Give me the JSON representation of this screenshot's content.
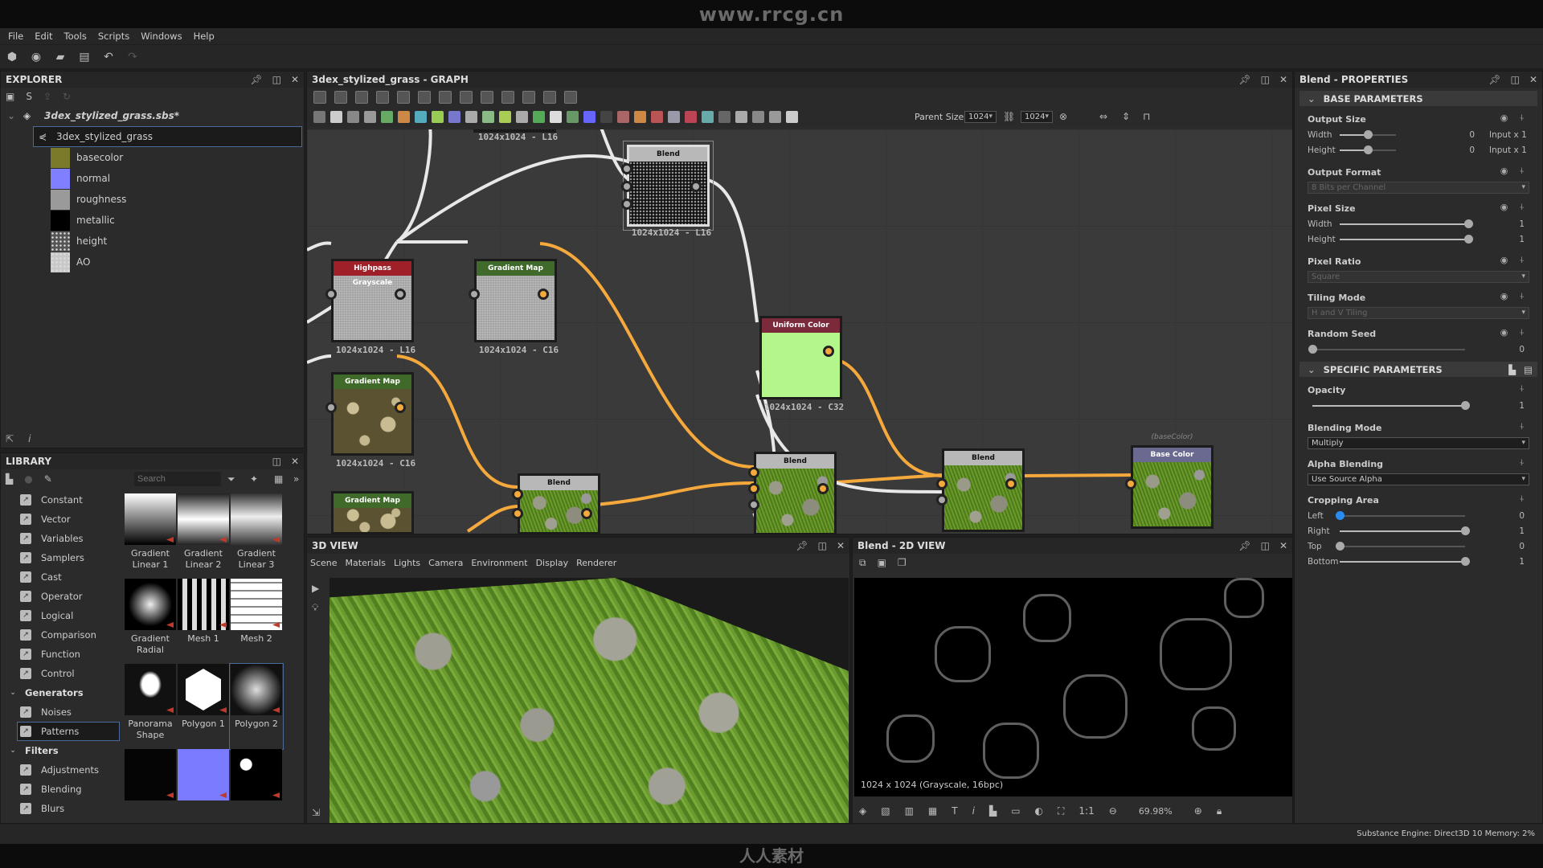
{
  "watermark_top": "www.rrcg.cn",
  "watermark_bottom": "人人素材",
  "menu": [
    "File",
    "Edit",
    "Tools",
    "Scripts",
    "Windows",
    "Help"
  ],
  "explorer": {
    "title": "EXPLORER",
    "package": "3dex_stylized_grass.sbs*",
    "graph": "3dex_stylized_grass",
    "outputs": [
      {
        "label": "basecolor",
        "color": "#7a7a2a"
      },
      {
        "label": "normal",
        "color": "#7f7fff"
      },
      {
        "label": "roughness",
        "color": "#9a9a9a"
      },
      {
        "label": "metallic",
        "color": "#000000"
      },
      {
        "label": "height",
        "color": "#555555"
      },
      {
        "label": "AO",
        "color": "#c8c8c8"
      }
    ]
  },
  "library": {
    "title": "LIBRARY",
    "search_placeholder": "Search",
    "categories": [
      {
        "label": "Constant"
      },
      {
        "label": "Vector"
      },
      {
        "label": "Variables"
      },
      {
        "label": "Samplers"
      },
      {
        "label": "Cast"
      },
      {
        "label": "Operator"
      },
      {
        "label": "Logical"
      },
      {
        "label": "Comparison"
      },
      {
        "label": "Function"
      },
      {
        "label": "Control"
      },
      {
        "label": "Generators",
        "group": true
      },
      {
        "label": "Noises"
      },
      {
        "label": "Patterns",
        "selected": true
      },
      {
        "label": "Filters",
        "group": true
      },
      {
        "label": "Adjustments"
      },
      {
        "label": "Blending"
      },
      {
        "label": "Blurs"
      }
    ],
    "items": [
      {
        "label": "Gradient Linear 1"
      },
      {
        "label": "Gradient Linear 2"
      },
      {
        "label": "Gradient Linear 3"
      },
      {
        "label": "Gradient Radial"
      },
      {
        "label": "Mesh 1"
      },
      {
        "label": "Mesh 2"
      },
      {
        "label": "Panorama Shape"
      },
      {
        "label": "Polygon 1"
      },
      {
        "label": "Polygon 2",
        "selected": true
      },
      {
        "label": ""
      },
      {
        "label": ""
      },
      {
        "label": ""
      }
    ]
  },
  "graph": {
    "title": "3dex_stylized_grass - GRAPH",
    "parent_size_label": "Parent Size:",
    "size_w": "1024",
    "size_h": "1024",
    "nodes": {
      "noise": {
        "caption": "1024x1024 - L16"
      },
      "blend_top": {
        "title": "Blend",
        "caption": "1024x1024 - L16"
      },
      "highpass": {
        "title": "Highpass Grayscale",
        "caption": "1024x1024 - L16"
      },
      "gradmap1": {
        "title": "Gradient Map",
        "caption": "1024x1024 - C16"
      },
      "gradmap2": {
        "title": "Gradient Map",
        "caption": "1024x1024 - C16"
      },
      "gradmap3": {
        "title": "Gradient Map"
      },
      "blend_low": {
        "title": "Blend"
      },
      "uniform": {
        "title": "Uniform Color",
        "caption": "1024x1024 - C32"
      },
      "blend_mid": {
        "title": "Blend"
      },
      "blend_right": {
        "title": "Blend"
      },
      "basecolor": {
        "title": "Base Color",
        "identifier": "(baseColor)"
      }
    },
    "colors": {
      "color_wire": "#f5a93c",
      "gray_wire": "#e8e8e8",
      "uniform_color": "#b4f58c"
    }
  },
  "view3d": {
    "title": "3D VIEW",
    "menu": [
      "Scene",
      "Materials",
      "Lights",
      "Camera",
      "Environment",
      "Display",
      "Renderer"
    ]
  },
  "view2d": {
    "title": "Blend - 2D VIEW",
    "info": "1024 x 1024 (Grayscale, 16bpc)",
    "zoom": "69.98%"
  },
  "properties": {
    "title": "Blend - PROPERTIES",
    "base_section": "BASE PARAMETERS",
    "output_size": {
      "label": "Output Size",
      "width_label": "Width",
      "height_label": "Height",
      "width": "0",
      "height": "0",
      "width_mode": "Input x 1",
      "height_mode": "Input x 1",
      "level": 0.5
    },
    "output_format": {
      "label": "Output Format",
      "value": "8 Bits per Channel"
    },
    "pixel_size": {
      "label": "Pixel Size",
      "width_label": "Width",
      "height_label": "Height",
      "width": "1",
      "height": "1",
      "level": 1
    },
    "pixel_ratio": {
      "label": "Pixel Ratio",
      "value": "Square"
    },
    "tiling_mode": {
      "label": "Tiling Mode",
      "value": "H and V Tiling"
    },
    "random_seed": {
      "label": "Random Seed",
      "value": "0",
      "level": 0
    },
    "specific_section": "SPECIFIC PARAMETERS",
    "opacity": {
      "label": "Opacity",
      "value": "1",
      "level": 1
    },
    "blending_mode": {
      "label": "Blending Mode",
      "value": "Multiply"
    },
    "alpha_blending": {
      "label": "Alpha Blending",
      "value": "Use Source Alpha"
    },
    "cropping": {
      "label": "Cropping Area",
      "rows": [
        {
          "label": "Left",
          "value": "0",
          "level": 0,
          "active": true
        },
        {
          "label": "Right",
          "value": "1",
          "level": 1
        },
        {
          "label": "Top",
          "value": "0",
          "level": 0
        },
        {
          "label": "Bottom",
          "value": "1",
          "level": 1
        }
      ]
    }
  },
  "status": "Substance Engine: Direct3D 10  Memory: 2%"
}
